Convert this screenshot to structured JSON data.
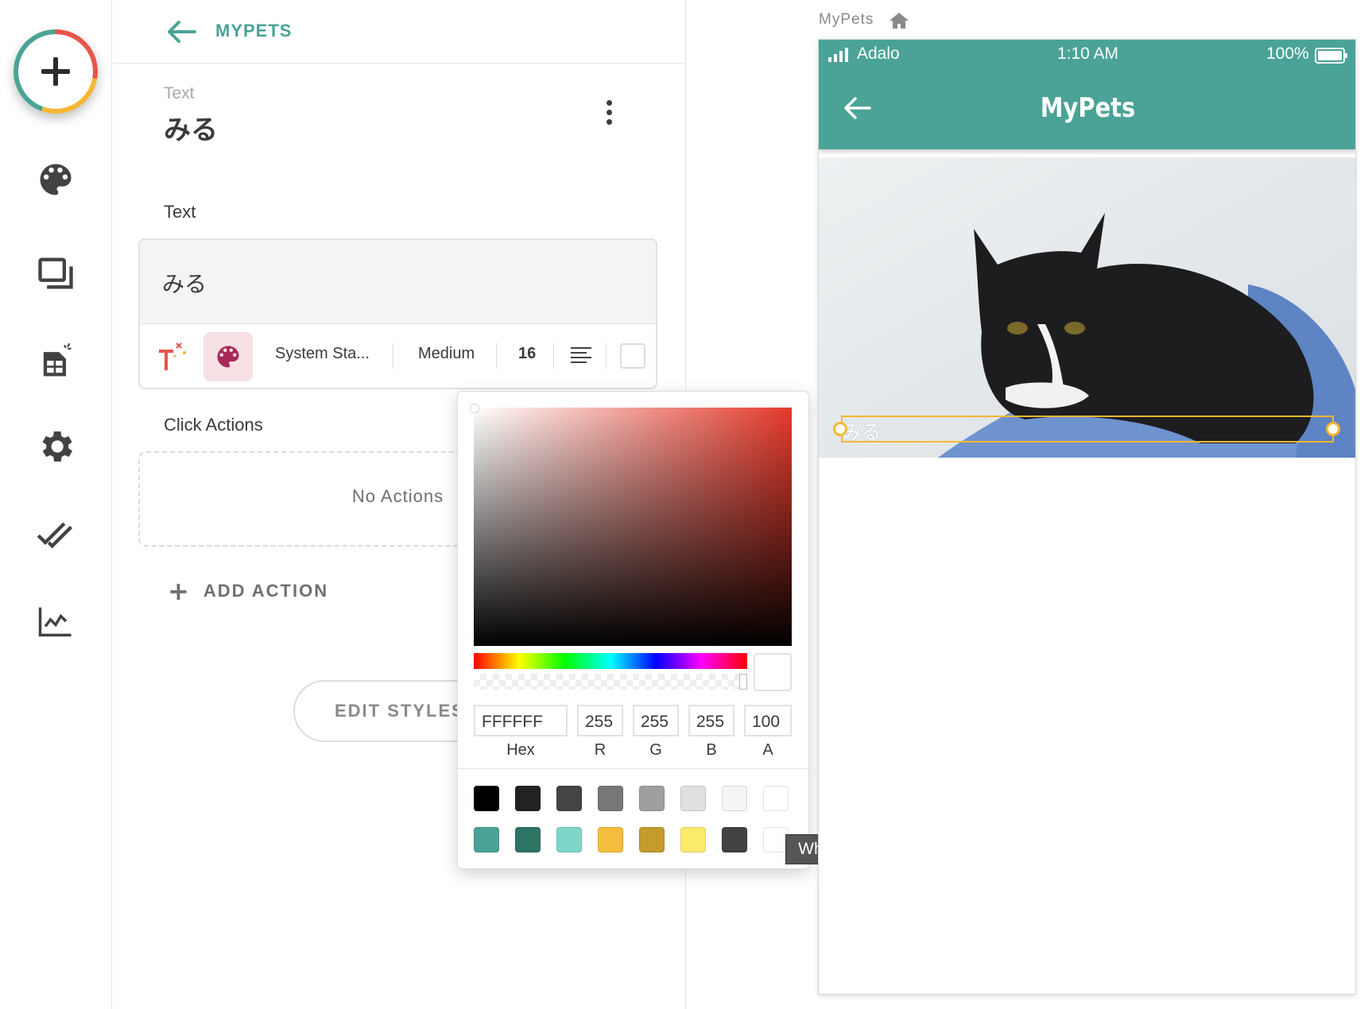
{
  "preview": {
    "title": "MyPets",
    "status": {
      "carrier": "Adalo",
      "time": "1:10 AM",
      "battery": "100%"
    },
    "nav_title": "MyPets",
    "selected_text": "みる",
    "image": "black-and-white cat lying on a blue cushion"
  },
  "panel": {
    "app_name": "MYPETS",
    "component_type": "Text",
    "component_name": "みる",
    "text_section_label": "Text",
    "text_value": "みる",
    "toolbar": {
      "font": "System Sta...",
      "weight": "Medium",
      "size": "16"
    },
    "click_actions_label": "Click Actions",
    "no_actions": "No Actions",
    "add_action": "ADD ACTION",
    "edit_styles": "EDIT STYLES"
  },
  "color_picker": {
    "hex": "FFFFFF",
    "r": "255",
    "g": "255",
    "b": "255",
    "a": "100",
    "labels": {
      "hex": "Hex",
      "r": "R",
      "g": "G",
      "b": "B",
      "a": "A"
    },
    "swatches_row1": [
      "#000000",
      "#222222",
      "#444444",
      "#777777",
      "#9e9e9e",
      "#e0e0e0",
      "#f5f5f5",
      "#ffffff"
    ],
    "swatches_row2": [
      "#4aa396",
      "#2e7465",
      "#7fd6c8",
      "#f4be3c",
      "#c49b2c",
      "#fcea6b",
      "#424242",
      "#ffffff"
    ],
    "tooltip": "White"
  },
  "colors": {
    "accent": "#4aa396",
    "selection": "#f4b731",
    "palette_active": "#a8295a"
  },
  "icons": [
    "add-icon",
    "palette-icon",
    "screens-icon",
    "database-icon",
    "settings-icon",
    "publish-icon",
    "analytics-icon",
    "back-arrow-icon",
    "more-vert-icon",
    "magic-text-icon",
    "align-left-icon",
    "home-icon",
    "signal-icon",
    "battery-icon"
  ]
}
